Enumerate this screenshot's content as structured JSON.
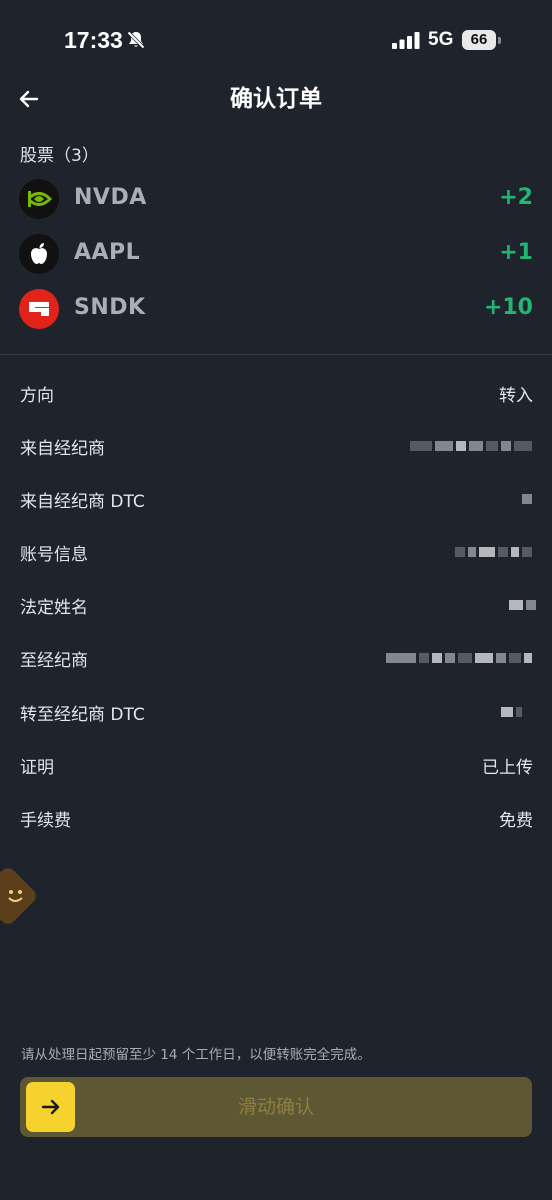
{
  "status_bar": {
    "time": "17:33",
    "network": "5G",
    "battery": "66"
  },
  "header": {
    "title": "确认订单"
  },
  "stocks": {
    "heading": "股票（3）",
    "items": [
      {
        "symbol": "NVDA",
        "qty": "+2",
        "logo": "nvidia-logo-icon"
      },
      {
        "symbol": "AAPL",
        "qty": "+1",
        "logo": "apple-logo-icon"
      },
      {
        "symbol": "SNDK",
        "qty": "+10",
        "logo": "sandisk-logo-icon"
      }
    ]
  },
  "details": {
    "direction": {
      "label": "方向",
      "value": "转入"
    },
    "from_broker": {
      "label": "来自经纪商"
    },
    "from_broker_dtc": {
      "label": "来自经纪商 DTC"
    },
    "account_info": {
      "label": "账号信息"
    },
    "legal_name": {
      "label": "法定姓名"
    },
    "to_broker": {
      "label": "至经纪商"
    },
    "to_broker_dtc": {
      "label": "转至经纪商 DTC"
    },
    "proof": {
      "label": "证明",
      "value": "已上传"
    },
    "fee": {
      "label": "手续费",
      "value": "免费"
    }
  },
  "notice": "请从处理日起预留至少 14 个工作日，以便转账完全完成。",
  "slider": {
    "label": "滑动确认"
  },
  "colors": {
    "background": "#1f232c",
    "positive": "#22b573",
    "accent": "#f6d22e",
    "nvidia": "#76b900",
    "sandisk": "#e2231a"
  }
}
